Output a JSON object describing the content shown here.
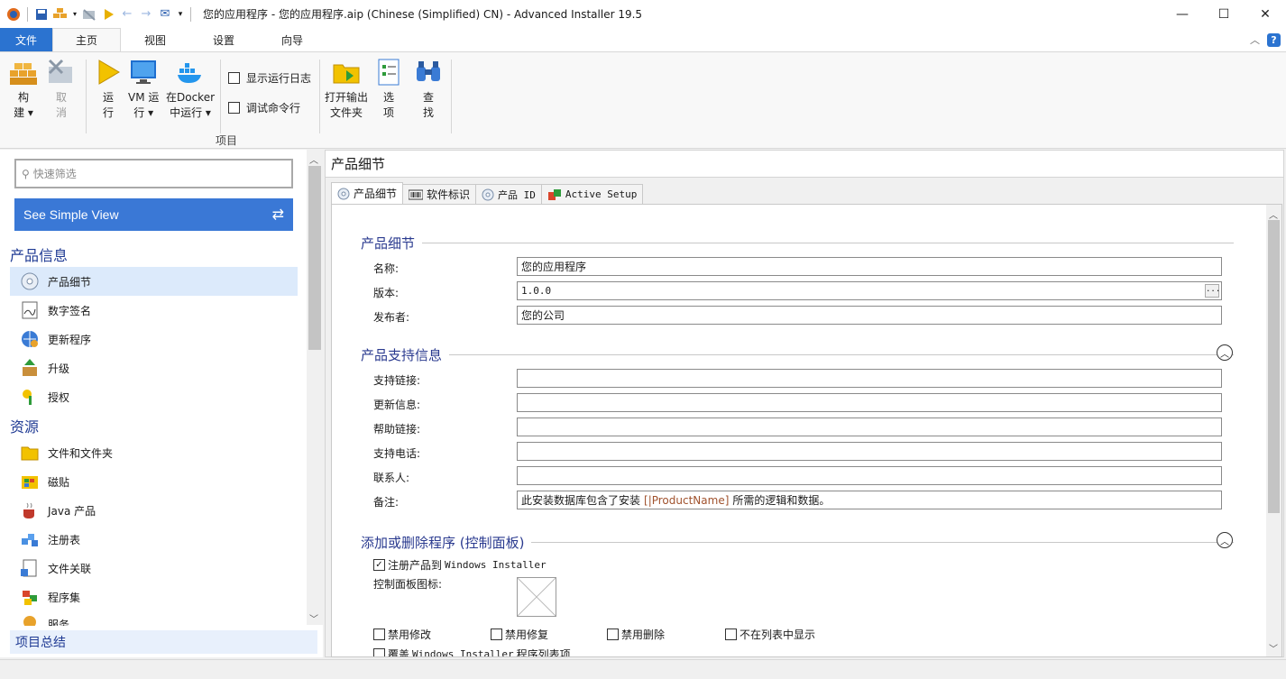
{
  "window": {
    "title": "您的应用程序 - 您的应用程序.aip (Chinese (Simplified) CN) - Advanced Installer 19.5",
    "controls": {
      "minimize": "—",
      "maximize": "☐",
      "close": "✕"
    }
  },
  "ribbon_tabs": [
    "文件",
    "主页",
    "视图",
    "设置",
    "向导"
  ],
  "ribbon": {
    "build": [
      "构",
      "建 ▾"
    ],
    "cancel": [
      "取",
      "消"
    ],
    "run": [
      "运",
      "行"
    ],
    "vm_run": [
      "VM 运",
      "行 ▾"
    ],
    "docker_run": [
      "在Docker",
      "中运行 ▾"
    ],
    "show_log": "显示运行日志",
    "debug_cmd": "调试命令行",
    "open_output": [
      "打开输出",
      "文件夹"
    ],
    "options": [
      "选",
      "项"
    ],
    "find": [
      "查",
      "找"
    ],
    "group_label": "项目"
  },
  "left": {
    "search_placeholder": "快速筛选",
    "simple_view": "See Simple View",
    "groups": {
      "product_info": "产品信息",
      "resources": "资源"
    },
    "items": [
      "产品细节",
      "数字签名",
      "更新程序",
      "升级",
      "授权",
      "文件和文件夹",
      "磁贴",
      "Java 产品",
      "注册表",
      "文件关联",
      "程序集",
      "服务"
    ],
    "summary": "项目总结"
  },
  "right": {
    "page_title": "产品细节",
    "tabs": [
      "产品细节",
      "软件标识",
      "产品 ID",
      "Active Setup"
    ],
    "section1": "产品细节",
    "fields1": {
      "name_label": "名称:",
      "name_value": "您的应用程序",
      "version_label": "版本:",
      "version_value": "1.0.0",
      "version_btn": "...",
      "publisher_label": "发布者:",
      "publisher_value": "您的公司"
    },
    "section2": "产品支持信息",
    "fields2": {
      "support_link": "支持链接:",
      "update_info": "更新信息:",
      "help_link": "帮助链接:",
      "support_phone": "支持电话:",
      "contact": "联系人:",
      "comments": "备注:",
      "comments_pre": "此安装数据库包含了安装",
      "comments_token": "[|ProductName]",
      "comments_post": "所需的逻辑和数据。"
    },
    "section3": "添加或删除程序 (控制面板)",
    "register_check": "注册产品到",
    "register_mono": "Windows Installer",
    "cp_icon_label": "控制面板图标:",
    "disable_modify": "禁用修改",
    "disable_repair": "禁用修复",
    "disable_remove": "禁用删除",
    "hide_in_list": "不在列表中显示",
    "override_pre": "覆盖",
    "override_mono": "Windows Installer",
    "override_post": "程序列表项"
  },
  "colors": {
    "accent": "#2b73d0",
    "section": "#2a3a8f",
    "selection": "#dceafb"
  }
}
